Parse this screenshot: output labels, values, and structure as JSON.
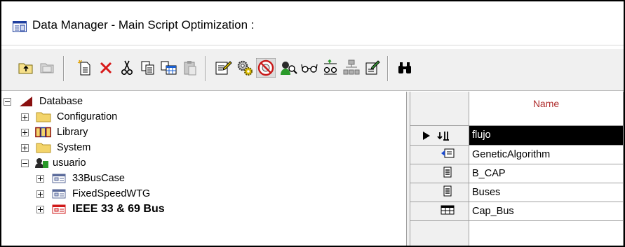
{
  "window": {
    "title": "Data Manager - Main Script Optimization :"
  },
  "toolbar": {
    "icons": [
      "folder-up-icon",
      "folder-disabled-icon",
      "new-object-icon",
      "delete-icon",
      "cut-icon",
      "copy-icon",
      "copy-with-children-icon",
      "paste-icon",
      "edit-icon",
      "gear-icon",
      "no-entry-icon",
      "user-magnifier-icon",
      "glasses-icon",
      "chart-glasses-icon",
      "network-icon",
      "edit-note-icon",
      "binoculars-icon"
    ]
  },
  "tree": {
    "nodes": [
      {
        "label": "Database",
        "expander": "minus",
        "icon": "database-icon"
      },
      {
        "label": "Configuration",
        "expander": "plus",
        "icon": "folder-icon"
      },
      {
        "label": "Library",
        "expander": "plus",
        "icon": "library-icon"
      },
      {
        "label": "System",
        "expander": "plus",
        "icon": "folder-icon"
      },
      {
        "label": "usuario",
        "expander": "minus",
        "icon": "user-icon"
      },
      {
        "label": "33BusCase",
        "expander": "plus",
        "icon": "project-icon"
      },
      {
        "label": "FixedSpeedWTG",
        "expander": "plus",
        "icon": "project-icon"
      },
      {
        "label": "IEEE 33 & 69 Bus",
        "expander": "plus",
        "icon": "project-active-icon"
      }
    ]
  },
  "grid": {
    "column_header": "Name",
    "rows": [
      {
        "name": "flujo",
        "icon": "load-flow-icon",
        "selected": true
      },
      {
        "name": "GeneticAlgorithm",
        "icon": "script-icon",
        "selected": false
      },
      {
        "name": "B_CAP",
        "icon": "document-icon",
        "selected": false
      },
      {
        "name": "Buses",
        "icon": "document-icon",
        "selected": false
      },
      {
        "name": "Cap_Bus",
        "icon": "table-icon",
        "selected": false
      }
    ]
  }
}
